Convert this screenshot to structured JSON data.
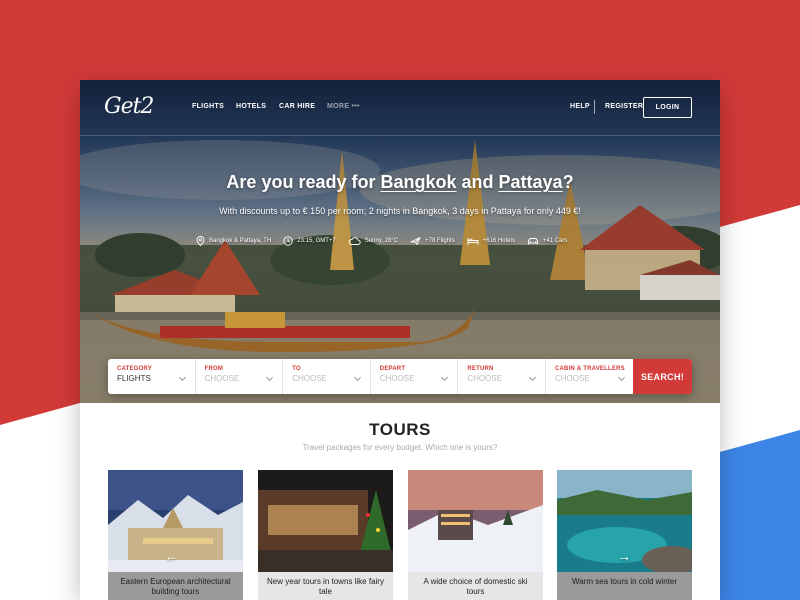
{
  "brand": {
    "logo_text": "Get2"
  },
  "nav": {
    "links": [
      "FLIGHTS",
      "HOTELS",
      "CAR HIRE",
      "MORE •••"
    ],
    "help": "HELP",
    "register": "REGISTER",
    "login": "LOGIN"
  },
  "hero": {
    "title_prefix": "Are you ready for ",
    "title_city1": "Bangkok",
    "title_and": " and ",
    "title_city2": "Pattaya",
    "title_suffix": "?",
    "subtitle": "With discounts up to € 150 per room; 2 nights in Bangkok, 3 days in Pattaya for only 449 €!",
    "facts": [
      {
        "icon": "location-pin-icon",
        "text": "Bangkok & Pattaya, TH"
      },
      {
        "icon": "clock-icon",
        "text": "23:15, GMT+7"
      },
      {
        "icon": "cloud-sun-icon",
        "text": "Sunny, 28°C"
      },
      {
        "icon": "plane-icon",
        "text": "+78 Flights"
      },
      {
        "icon": "bed-icon",
        "text": "+616 Hotels"
      },
      {
        "icon": "car-icon",
        "text": "+41 Cars"
      }
    ]
  },
  "search": {
    "fields": [
      {
        "label": "CATEGORY",
        "value": "FLIGHTS"
      },
      {
        "label": "FROM",
        "value": "CHOOSE"
      },
      {
        "label": "TO",
        "value": "CHOOSE"
      },
      {
        "label": "DEPART",
        "value": "CHOOSE"
      },
      {
        "label": "RETURN",
        "value": "CHOOSE"
      },
      {
        "label": "CABIN & TRAVELLERS",
        "value": "CHOOSE"
      }
    ],
    "button": "SEARCH!"
  },
  "tours": {
    "title": "TOURS",
    "subtitle": "Travel packages for every budget. Which one is yours?",
    "cards": [
      {
        "caption": "Eastern European architectural building tours"
      },
      {
        "caption": "New year tours in towns like fairy tale"
      },
      {
        "caption": "A wide choice of domestic ski tours"
      },
      {
        "caption": "Warm sea tours in cold winter"
      }
    ]
  },
  "colors": {
    "accent": "#d23a38",
    "background_red": "#d23a38",
    "background_blue": "#3d86e8"
  }
}
